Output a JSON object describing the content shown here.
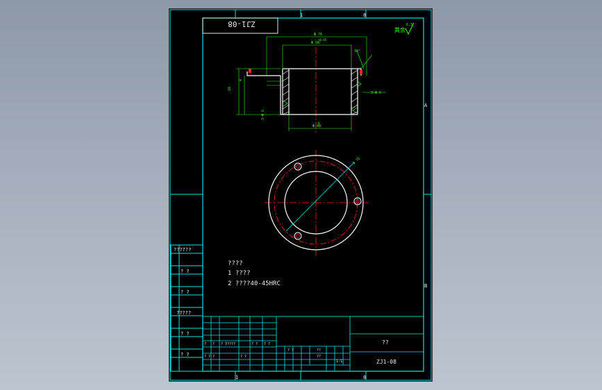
{
  "drawing": {
    "code": "ZJ1-08",
    "title_block_name": "??",
    "title_block_code": "ZJ1-08",
    "roughness_note": "其余",
    "roughness_value": "6.3"
  },
  "side_labels": [
    "??????",
    "? ?",
    "? ?",
    "?????",
    "? ?",
    "? ?"
  ],
  "notes": {
    "heading": "????",
    "line1": "1 ????",
    "line2": "2 ????40-45HRC"
  },
  "zone_letters": {
    "top_a": "A",
    "right_a": "A",
    "right_b": "B"
  },
  "zone_numbers": {
    "top_1": "1",
    "top_8": "8",
    "bottom_1": "1",
    "bottom_8": "8"
  },
  "dimensions": {
    "overall_width": "Φ 78",
    "inner_width": "Φ 58",
    "chamfer_angle": "30°",
    "height_left": "28",
    "height_small": "4",
    "bottom_dia": "Φ 48",
    "hole_note": "3-Φ 6",
    "circle_dia": "Φ 76",
    "tol_1": "+0.05",
    "tol_2": "0"
  },
  "title_block": {
    "cells": [
      "?",
      "?",
      "? ?",
      "?????",
      "? ?",
      "? ?",
      "? ? ?",
      "? ?",
      "? ?",
      "??",
      "1:1",
      "??"
    ]
  },
  "colors": {
    "border": "#00e5e5",
    "outline": "#ffffff",
    "center": "#ff2020",
    "dimension": "#39ff14"
  }
}
